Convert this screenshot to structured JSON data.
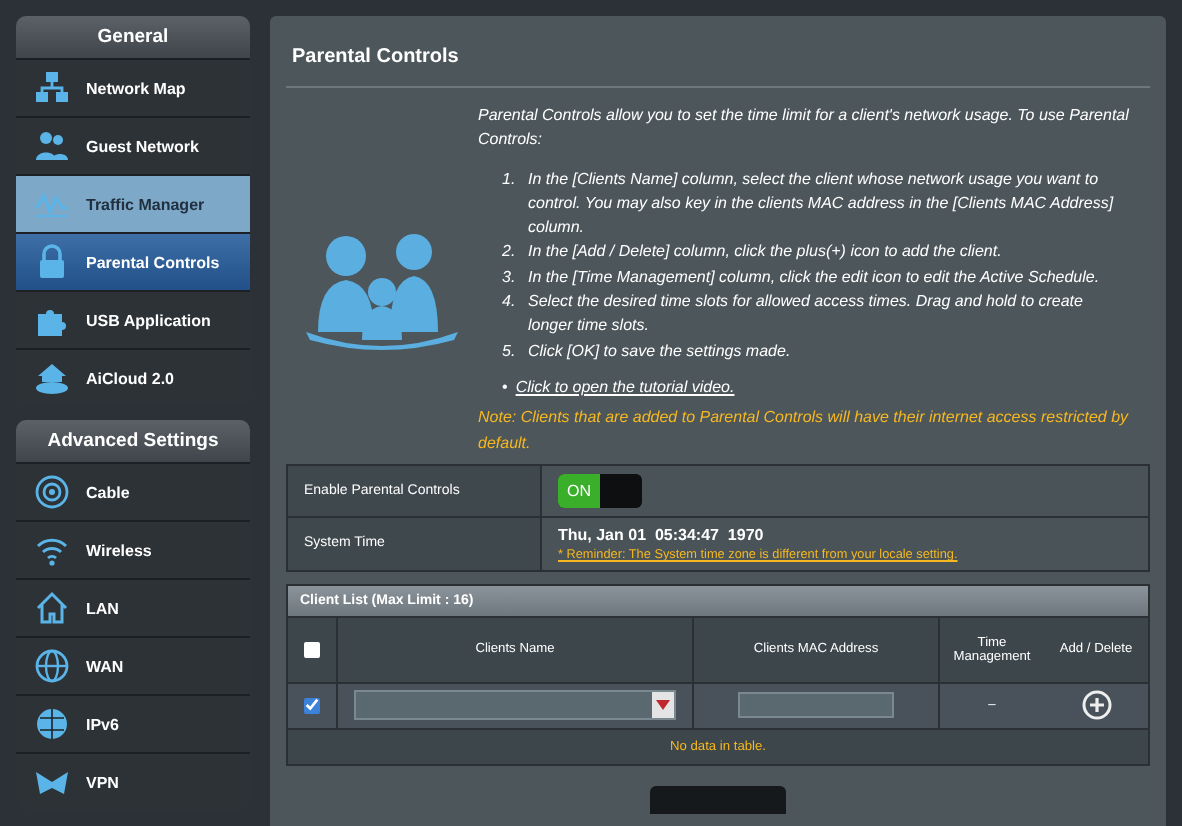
{
  "sidebar": {
    "sections": [
      {
        "title": "General",
        "items": [
          {
            "label": "Network Map",
            "selected": false,
            "highlighted": false
          },
          {
            "label": "Guest Network",
            "selected": false,
            "highlighted": false
          },
          {
            "label": "Traffic Manager",
            "selected": false,
            "highlighted": true
          },
          {
            "label": "Parental Controls",
            "selected": true,
            "highlighted": false
          },
          {
            "label": "USB Application",
            "selected": false,
            "highlighted": false
          },
          {
            "label": "AiCloud 2.0",
            "selected": false,
            "highlighted": false
          }
        ]
      },
      {
        "title": "Advanced Settings",
        "items": [
          {
            "label": "Cable",
            "selected": false,
            "highlighted": false
          },
          {
            "label": "Wireless",
            "selected": false,
            "highlighted": false
          },
          {
            "label": "LAN",
            "selected": false,
            "highlighted": false
          },
          {
            "label": "WAN",
            "selected": false,
            "highlighted": false
          },
          {
            "label": "IPv6",
            "selected": false,
            "highlighted": false
          },
          {
            "label": "VPN",
            "selected": false,
            "highlighted": false
          }
        ]
      }
    ]
  },
  "main": {
    "title": "Parental Controls",
    "intro": "Parental Controls allow you to set the time limit for a client's network usage. To use Parental Controls:",
    "steps": [
      {
        "number": "1.",
        "text": "In the [Clients Name] column, select the client whose network usage you want to control. You may also key in the clients MAC address in the [Clients MAC Address] column."
      },
      {
        "number": "2.",
        "text": "In the [Add / Delete] column, click the plus(+) icon to add the client."
      },
      {
        "number": "3.",
        "text": "In the [Time Management] column, click the edit icon to edit the Active Schedule."
      },
      {
        "number": "4.",
        "text": "Select the desired time slots for allowed access times. Drag and hold to create longer time slots."
      },
      {
        "number": "5.",
        "text": "Click [OK] to save the settings made."
      }
    ],
    "tutorial_bullet": "•",
    "tutorial_link": "Click to open the tutorial video.",
    "note": "Note: Clients that are added to Parental Controls will have their internet access restricted by default.",
    "settings": [
      {
        "kind": "toggle",
        "label": "Enable Parental Controls",
        "value": "ON",
        "on": true
      },
      {
        "kind": "time",
        "label": "System Time",
        "value": "Thu, Jan 01  05:34:47  1970",
        "reminder": "* Reminder: The System time zone is different from your locale setting."
      }
    ],
    "client_list": {
      "title": "Client List (Max Limit : 16)",
      "select_all_checked": false,
      "columns": [
        "Clients Name",
        "Clients MAC Address",
        "Time Management",
        "Add / Delete"
      ],
      "entry_row": {
        "checked": true,
        "time_management": "–"
      },
      "empty_message": "No data in table."
    }
  }
}
